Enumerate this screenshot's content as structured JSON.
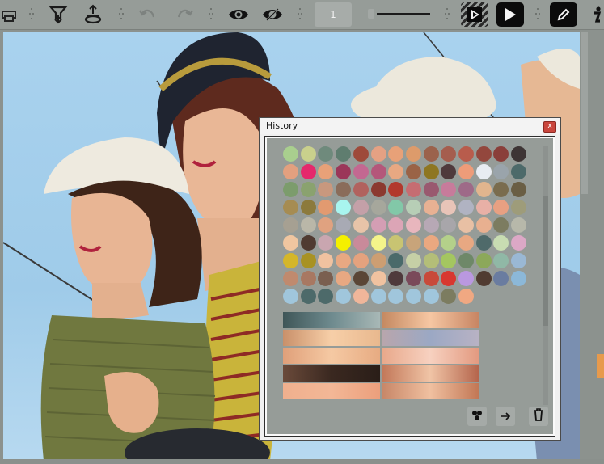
{
  "toolbar": {
    "brush_size": "1",
    "icons": [
      "print-icon",
      "funnel-down-icon",
      "funnel-up-icon",
      "undo-icon",
      "redo-icon",
      "eye-icon",
      "eye-slash-icon",
      "play-frame-icon",
      "play-icon",
      "pencil-icon",
      "info-icon"
    ]
  },
  "history": {
    "title": "History",
    "close_label": "x",
    "swatches": [
      [
        "#a9cf8e",
        "#c9d08c",
        "#6f8a7c",
        "#5f7d6f",
        "#9e4a3a",
        "#e5a183",
        "#e8a178",
        "#dd9b6b",
        "#9b624c",
        "#a55d4e",
        "#b85c4c",
        "#93473d",
        "#8a3f3a",
        "#3e3535"
      ],
      [
        "#e2a07f",
        "#e5286c",
        "#e8a178",
        "#9b3759",
        "#c36891",
        "#b4577a",
        "#e8a882",
        "#9a6346",
        "#8e7621",
        "#4f3a3c",
        "#ee9c79",
        "#e8ecf2",
        "#9aa4ab",
        "#4d6a6a"
      ],
      [
        "#7c9c6c",
        "#8aa26f",
        "#c8987e",
        "#8a6c5a",
        "#b1625e",
        "#8b3930",
        "#b2382d",
        "#c66d72",
        "#99596f",
        "#c77b9b",
        "#9e6a88",
        "#e2b58e",
        "#7a6c4e",
        "#6a5e44"
      ],
      [
        "#a68c52",
        "#8c7a3c",
        "#e29a70",
        "#a8f5ef",
        "#c4a0a8",
        "#a6a79c",
        "#82c8a8",
        "#b7ceb6",
        "#e8b193",
        "#e8c4b8",
        "#b0b3c2",
        "#e8b0a6",
        "#e8a082",
        "#9e9c7a"
      ],
      [
        "#a6a092",
        "#bab7a8",
        "#e0a280",
        "#a8aab4",
        "#e8c4a8",
        "#d49eb4",
        "#dca5b6",
        "#e8b6bd",
        "#b7a8b5",
        "#a8a6aa",
        "#e8c0a4",
        "#e8b090",
        "#7c7c60",
        "#b7b8aa"
      ],
      [
        "#f0c6a0",
        "#503b31",
        "#c9a6b0",
        "#f5f000",
        "#c98a9a",
        "#f4f48a",
        "#c8c472",
        "#c8a47a",
        "#eaa880",
        "#b4d08a",
        "#e8a882",
        "#4f6a6a",
        "#c8dcb2",
        "#dca8c6"
      ],
      [
        "#d4b62a",
        "#a89223",
        "#f0c2a0",
        "#e8a882",
        "#e4a27e",
        "#cd9e72",
        "#4a6a6a",
        "#c6d0a6",
        "#b4be78",
        "#a4c660",
        "#6e8868",
        "#8ca85a",
        "#90b8a6",
        "#9ab8d4"
      ],
      [
        "#c08a6e",
        "#a87862",
        "#7a5f50",
        "#e8a882",
        "#5a4636",
        "#f0c2a0",
        "#4f3a3c",
        "#7a4a5a",
        "#c84a3a",
        "#d83830",
        "#ba98e0",
        "#503b31",
        "#6a7ca0",
        "#8cb8d8"
      ],
      [
        "#a0c6dc",
        "#4d6a6a",
        "#4d6a6a",
        "#a0c6dc",
        "#f0b69a",
        "#a0c6dc",
        "#a0c6dc",
        "#a0c6dc",
        "#a0c6dc",
        "#7c7c60",
        "#f0a882"
      ]
    ],
    "gradients": [
      {
        "from": "#3f5658",
        "mid": "#6e8a8e",
        "to": "#a8b8b6"
      },
      {
        "from": "#c48860",
        "mid": "#f6c7a3",
        "to": "#c78563"
      },
      {
        "from": "#c9906a",
        "mid": "#f7cfa8",
        "to": "#e8b88e"
      },
      {
        "from": "#b9a6ac",
        "mid": "#9ba8c4",
        "to": "#b8b2c4"
      },
      {
        "from": "#e0a07a",
        "mid": "#f5c9a3",
        "to": "#e7ab82"
      },
      {
        "from": "#e8a88a",
        "mid": "#f7d1c0",
        "to": "#e39a80"
      },
      {
        "from": "#6a4a3a",
        "mid": "#3a2820",
        "to": "#2a1e18"
      },
      {
        "from": "#c27758",
        "mid": "#f0c4a6",
        "to": "#b5654c"
      },
      {
        "from": "#f0b08e",
        "mid": "#f3b796",
        "to": "#ec9f7c"
      },
      {
        "from": "#c78667",
        "mid": "#f0c0a0",
        "to": "#c27755"
      }
    ],
    "buttons": {
      "palette": "palette-icon",
      "apply": "arrow-right-icon",
      "delete": "trash-icon"
    }
  }
}
